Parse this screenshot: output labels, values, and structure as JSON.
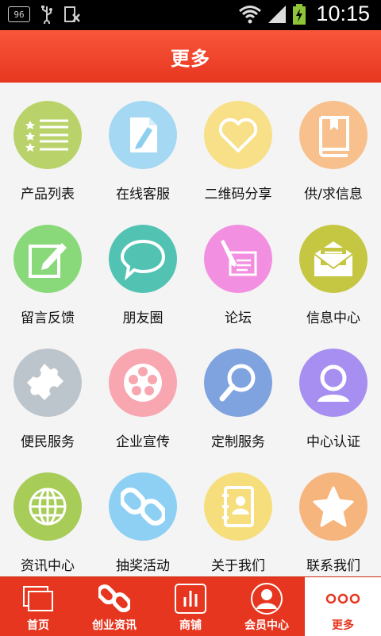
{
  "status": {
    "badge": "96",
    "time": "10:15"
  },
  "header": {
    "title": "更多"
  },
  "grid": [
    {
      "label": "产品列表",
      "color": "#b9d36a",
      "icon": "list-icon"
    },
    {
      "label": "在线客服",
      "color": "#a5d9f3",
      "icon": "document-pencil-icon"
    },
    {
      "label": "二维码分享",
      "color": "#f7e088",
      "icon": "heart-icon"
    },
    {
      "label": "供/求信息",
      "color": "#f7c08c",
      "icon": "book-icon"
    },
    {
      "label": "留言反馈",
      "color": "#89d97a",
      "icon": "edit-icon"
    },
    {
      "label": "朋友圈",
      "color": "#52c3b3",
      "icon": "chat-bubble-icon"
    },
    {
      "label": "论坛",
      "color": "#f38fe0",
      "icon": "pen-paper-icon"
    },
    {
      "label": "信息中心",
      "color": "#c5c742",
      "icon": "mail-icon"
    },
    {
      "label": "便民服务",
      "color": "#bdc5cc",
      "icon": "puzzle-icon"
    },
    {
      "label": "企业宣传",
      "color": "#f8a6b0",
      "icon": "film-reel-icon"
    },
    {
      "label": "定制服务",
      "color": "#7fa3de",
      "icon": "magnifier-icon"
    },
    {
      "label": "中心认证",
      "color": "#a68ff0",
      "icon": "user-icon"
    },
    {
      "label": "资讯中心",
      "color": "#a7cc58",
      "icon": "globe-icon"
    },
    {
      "label": "抽奖活动",
      "color": "#8ed0f3",
      "icon": "chain-link-icon"
    },
    {
      "label": "关于我们",
      "color": "#f7de7c",
      "icon": "contact-book-icon"
    },
    {
      "label": "联系我们",
      "color": "#f7b57e",
      "icon": "star-icon"
    }
  ],
  "tabs": [
    {
      "label": "首页",
      "icon": "pages-icon"
    },
    {
      "label": "创业资讯",
      "icon": "chain-icon"
    },
    {
      "label": "商铺",
      "icon": "bar-chart-icon"
    },
    {
      "label": "会员中心",
      "icon": "member-icon"
    },
    {
      "label": "更多",
      "icon": "more-dots-icon",
      "active": true
    }
  ]
}
